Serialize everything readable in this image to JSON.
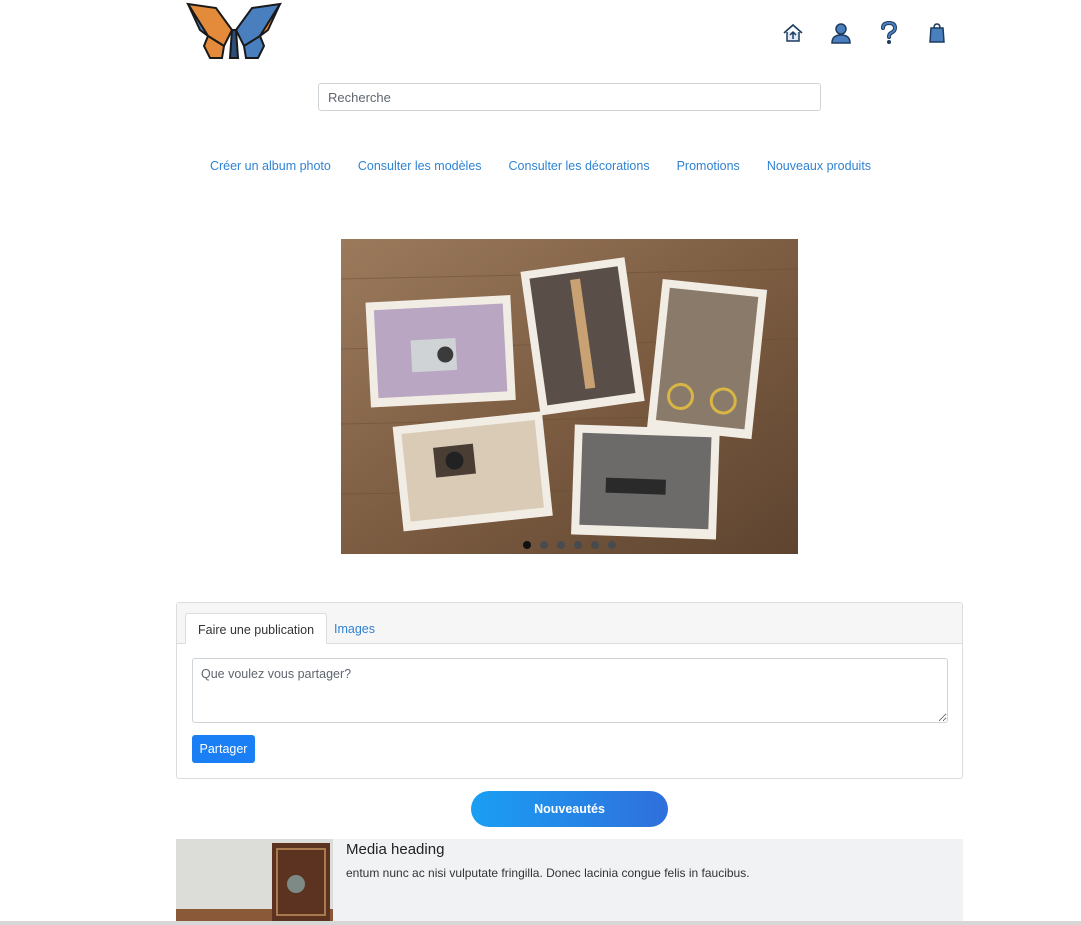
{
  "header": {
    "logo": "butterfly-logo",
    "icons": [
      "home-icon",
      "user-icon",
      "help-icon",
      "shopping-bag-icon"
    ]
  },
  "search": {
    "placeholder": "Recherche"
  },
  "nav": {
    "items": [
      "Créer un album photo",
      "Consulter les modèles",
      "Consulter les décorations",
      "Promotions",
      "Nouveaux produits"
    ]
  },
  "carousel": {
    "slide_count": 6,
    "active_index": 0
  },
  "publication": {
    "tabs": [
      "Faire une publication",
      "Images"
    ],
    "active_tab": 0,
    "textarea_placeholder": "Que voulez vous partager?",
    "share_label": "Partager"
  },
  "nouveautes_label": "Nouveautés",
  "media": {
    "heading": "Media heading",
    "text": "entum nunc ac nisi vulputate fringilla. Donec lacinia congue felis in faucibus."
  },
  "colors": {
    "link": "#2f83d3",
    "primary": "#1a7ff5",
    "gradient_start": "#1a9ff3",
    "gradient_end": "#2f6fdc"
  }
}
